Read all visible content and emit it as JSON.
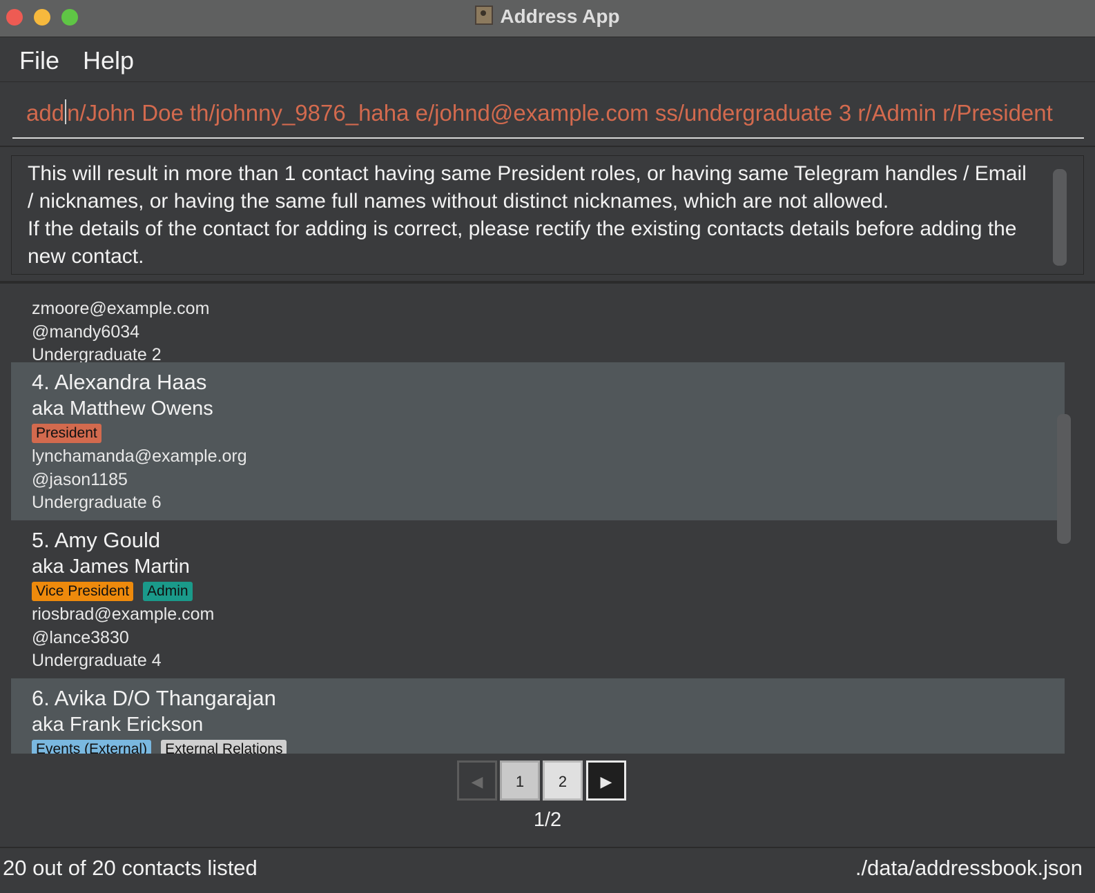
{
  "window": {
    "title": "Address App"
  },
  "menu": [
    "File",
    "Help"
  ],
  "command": {
    "before_caret": "add",
    "after_caret": "n/John Doe th/johnny_9876_haha e/johnd@example.com ss/undergraduate 3 r/Admin r/President"
  },
  "result": {
    "line1": "This will result in more than 1 contact having same President roles, or having same Telegram handles / Email / nicknames, or having the same full names without distinct nicknames, which are not allowed.",
    "line2": "If the details of the contact for adding is correct, please rectify the existing contacts details before adding the new contact."
  },
  "contacts": [
    {
      "name": "",
      "nickname": "",
      "tags": [],
      "email": "zmoore@example.com",
      "telegram": "@mandy6034",
      "status": "Undergraduate 2"
    },
    {
      "name": "4. Alexandra Haas",
      "nickname": "aka Matthew Owens",
      "tags": [
        {
          "label": "President",
          "color": "#d36a4e"
        }
      ],
      "email": "lynchamanda@example.org",
      "telegram": "@jason1185",
      "status": "Undergraduate 6"
    },
    {
      "name": "5. Amy Gould",
      "nickname": "aka James Martin",
      "tags": [
        {
          "label": "Vice President",
          "color": "#ee8a0c"
        },
        {
          "label": "Admin",
          "color": "#1a9a8a"
        }
      ],
      "email": "riosbrad@example.com",
      "telegram": "@lance3830",
      "status": "Undergraduate 4"
    },
    {
      "name": "6. Avika D/O Thangarajan",
      "nickname": "aka Frank Erickson",
      "tags": [
        {
          "label": "Events (External)",
          "color": "#7ab8e0"
        },
        {
          "label": "External Relations",
          "color": "#cfcfcf"
        }
      ],
      "email": "",
      "telegram": "",
      "status": ""
    }
  ],
  "pagination": {
    "prev_icon": "chevron-left-icon",
    "pages": [
      "1",
      "2"
    ],
    "next_icon": "chevron-right-icon",
    "indicator": "1/2"
  },
  "status": {
    "left": "20 out of 20 contacts listed",
    "right": "./data/addressbook.json"
  }
}
